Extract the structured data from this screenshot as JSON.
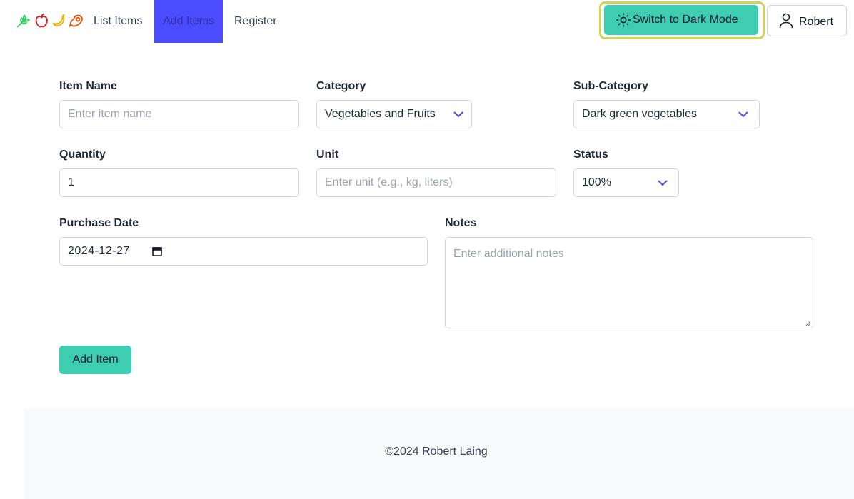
{
  "nav": {
    "logo_icons": [
      "wheat-icon",
      "apple-icon",
      "banana-icon",
      "meat-icon"
    ],
    "links": [
      {
        "label": "List Items"
      },
      {
        "label": "Add Items",
        "active": true
      },
      {
        "label": "Register"
      }
    ],
    "dark_mode_label": "Switch to Dark Mode",
    "user_name": "Robert"
  },
  "form": {
    "item_name": {
      "label": "Item Name",
      "placeholder": "Enter item name"
    },
    "category": {
      "label": "Category",
      "value": "Vegetables and Fruits"
    },
    "sub_category": {
      "label": "Sub-Category",
      "value": "Dark green vegetables"
    },
    "quantity": {
      "label": "Quantity",
      "value": "1"
    },
    "unit": {
      "label": "Unit",
      "placeholder": "Enter unit (e.g., kg, liters)"
    },
    "status": {
      "label": "Status",
      "value": "100%"
    },
    "purchase_date": {
      "label": "Purchase Date",
      "value": "2024-12-27"
    },
    "notes": {
      "label": "Notes",
      "placeholder": "Enter additional notes"
    },
    "submit_label": "Add Item"
  },
  "footer": {
    "text": "©2024 Robert Laing"
  },
  "colors": {
    "accent": "#3ecdb0",
    "nav_active": "#4b4bff",
    "focus_ring": "#cfd35a"
  }
}
